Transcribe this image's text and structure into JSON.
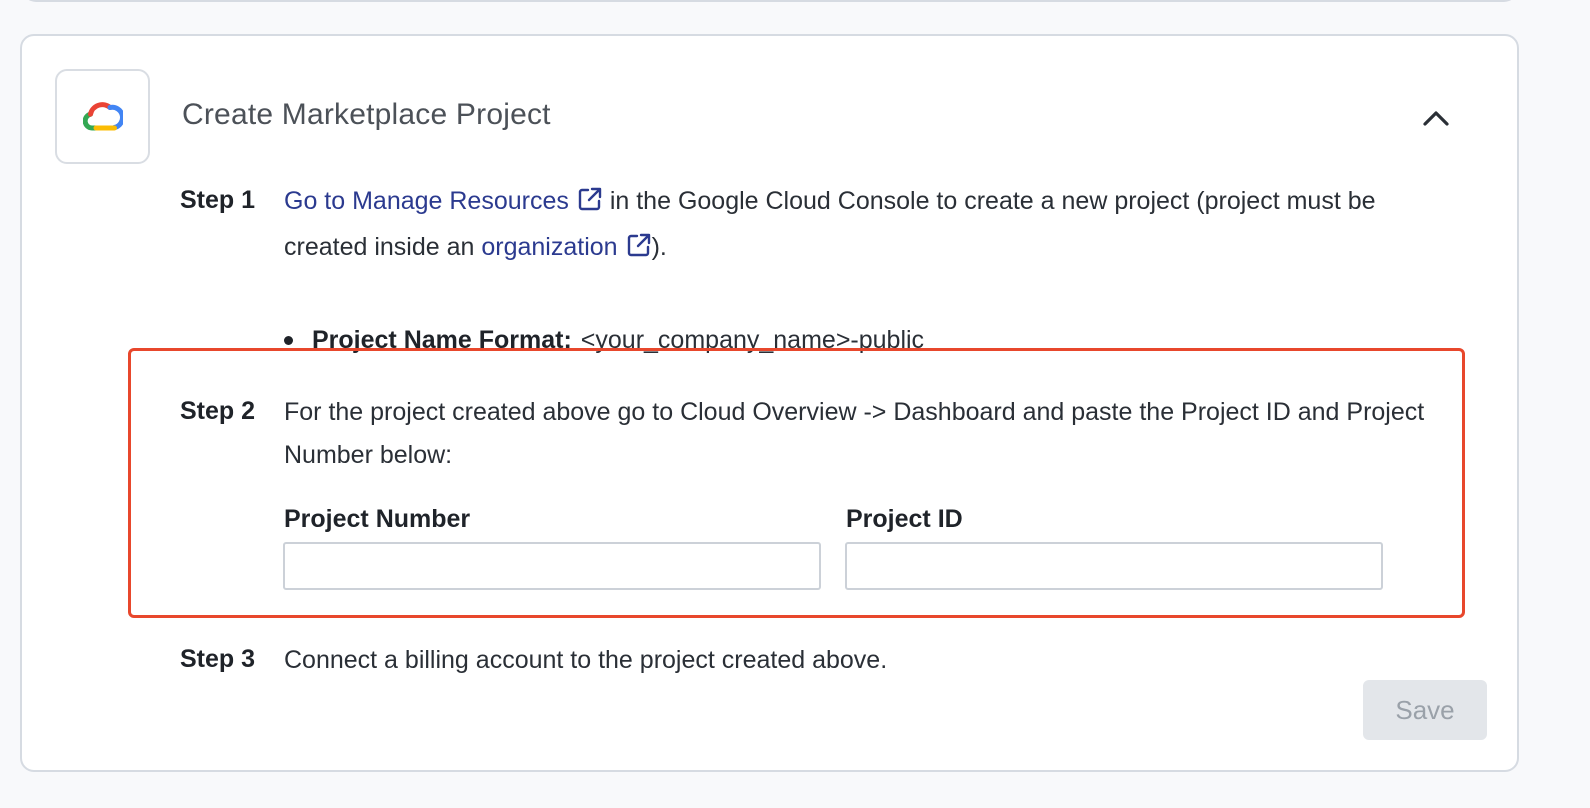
{
  "card": {
    "title": "Create Marketplace Project"
  },
  "icons": {
    "logo": "google-cloud-icon",
    "collapse": "chevron-up-icon",
    "external": "external-link-icon"
  },
  "steps": {
    "step1": {
      "label": "Step 1",
      "link1": "Go to Manage Resources",
      "text1": " in the Google Cloud Console to create a new project (project must be created inside an ",
      "link2": "organization",
      "text2": ").",
      "bullet_label": "Project Name Format:",
      "bullet_value": "<your_company_name>-public"
    },
    "step2": {
      "label": "Step 2",
      "text": "For the project created above go to Cloud Overview -> Dashboard and paste the Project ID and Project Number below:",
      "project_number_label": "Project Number",
      "project_number_value": "",
      "project_id_label": "Project ID",
      "project_id_value": ""
    },
    "step3": {
      "label": "Step 3",
      "text": "Connect a billing account to the project created above."
    }
  },
  "actions": {
    "save_label": "Save"
  },
  "colors": {
    "link": "#2b3a8f",
    "highlight": "#e8472c",
    "disabled_button_bg": "#e3e6ea"
  }
}
